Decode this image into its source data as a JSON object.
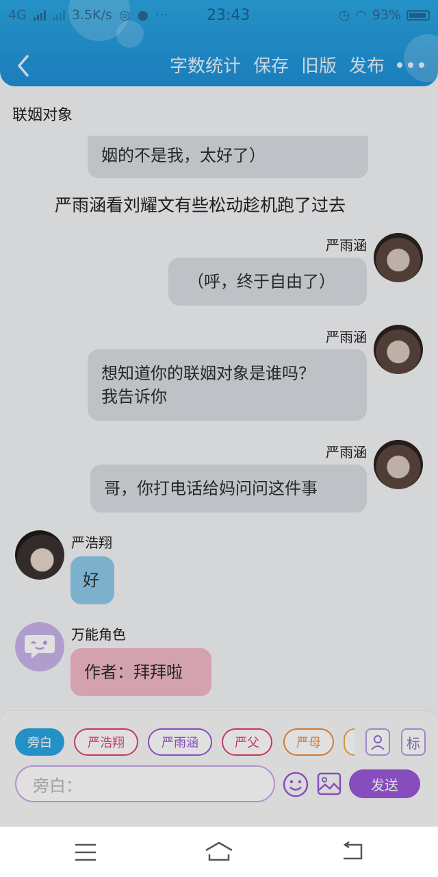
{
  "status_bar": {
    "network": "4G",
    "speed": "3.5K/s",
    "time": "23:43",
    "battery": "93%"
  },
  "header": {
    "actions": [
      "字数统计",
      "保存",
      "旧版",
      "发布"
    ]
  },
  "chat": {
    "section_title": "联姻对象",
    "partial_bubble": "姻的不是我，太好了）",
    "narration": "严雨涵看刘耀文有些松动趁机跑了过去",
    "messages": [
      {
        "speaker": "严雨涵",
        "lines": [
          "（呼，终于自由了）"
        ],
        "side": "right"
      },
      {
        "speaker": "严雨涵",
        "lines": [
          "想知道你的联姻对象是谁吗？",
          "我告诉你"
        ],
        "side": "right"
      },
      {
        "speaker": "严雨涵",
        "lines": [
          "哥，你打电话给妈问问这件事"
        ],
        "side": "right"
      },
      {
        "speaker": "严浩翔",
        "lines": [
          "好"
        ],
        "side": "left"
      },
      {
        "speaker": "万能角色",
        "lines": [
          "作者：拜拜啦"
        ],
        "side": "left"
      }
    ]
  },
  "composer": {
    "chips": [
      "旁白",
      "严浩翔",
      "严雨涵",
      "严父",
      "严母"
    ],
    "icon_buttons": {
      "mark_label": "标"
    },
    "input_placeholder": "旁白：",
    "send_label": "发送"
  },
  "colors": {
    "header": "#1f8fd6",
    "bubble_right": "#d9dde3",
    "bubble_boy": "#8ec9ea",
    "bubble_omni": "#f2b8c6",
    "send": "#9a58d8"
  }
}
